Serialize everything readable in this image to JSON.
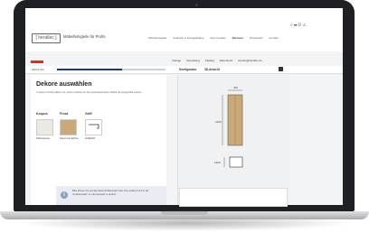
{
  "header": {
    "logo_text": "[ herallec ]",
    "tagline": "Möbelfertigteile für Profis.",
    "icons": [
      "search-icon",
      "list-icon",
      "document-icon",
      "user-icon"
    ],
    "nav": [
      "Möbelfertigteile",
      "Software & Fertigteilpläne",
      "über herallec",
      "Services",
      "Downloads",
      "Kontakt"
    ],
    "nav_active": "Services"
  },
  "account": {
    "items": [
      "Vorlage",
      "Verwaltung",
      "Katalog",
      "Warenkorb",
      "studier@herallec.de"
    ]
  },
  "configurator": {
    "step_label": "Schritt 3/4",
    "progress": 0.6,
    "tabs": [
      "Konfigurator",
      "3D-Ansicht"
    ],
    "title": "Dekore auswählen",
    "description": "In diesem Schritt wählen wir unseren Dekore für die personalisierbaren Möbel die ausgewählt werden",
    "columns": [
      {
        "label": "Korpus",
        "swatch_color": "#ece9e2",
        "value": "Platinweiss"
      },
      {
        "label": "Front",
        "swatch_color": "#c9a879",
        "value": "Sanremo Eiche"
      },
      {
        "label": "Griff",
        "swatch_color": "#ffffff",
        "value": "AVENIO"
      }
    ],
    "notice": "Bitte klicken Sie auf das Dekor/Griffauswahl oder eine andere Front in der Vorabauswahl, um die Auswahl zu ändern.",
    "colors": {
      "accent": "#1f3a66",
      "brand": "#c0392b"
    }
  },
  "preview": {
    "dims": [
      "2100",
      "400",
      "1200"
    ]
  }
}
